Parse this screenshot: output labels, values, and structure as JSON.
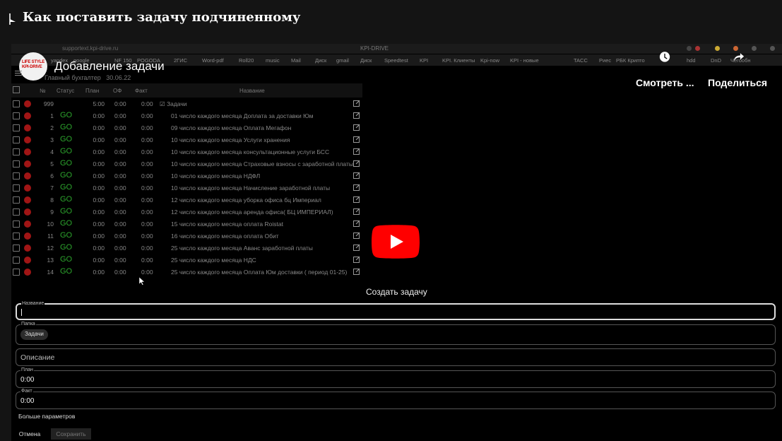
{
  "page": {
    "title": "Как поставить задачу подчиненному"
  },
  "browser": {
    "url": "supportext.kpi-drive.ru",
    "window_title": "KPI-DRIVE",
    "bookmarks": [
      "yandex",
      "google",
      "NF 150",
      "POGODA",
      "2ГИС",
      "Word-pdf",
      "Roll20",
      "music",
      "Mail",
      "Диск",
      "gmail",
      "Диск",
      "Speedtest",
      "KPI",
      "KPI. Клиенты",
      "Kpi-now",
      "KPI - новые",
      "TACC",
      "Риес",
      "РБК Крипто",
      "hdd",
      "DnD",
      "Чегообн"
    ]
  },
  "youtube": {
    "channel_logo_text": "LIFE STYLE KPI-DRIVE",
    "video_title": "Добавление задачи",
    "watch_later_label": "Смотреть ...",
    "share_label": "Поделиться"
  },
  "app": {
    "role": "Главный бухгалтер",
    "date": "30.06.22",
    "table": {
      "headers": {
        "num": "№",
        "status": "Статус",
        "plan": "План",
        "of": "ОФ",
        "fact": "Факт",
        "name": "Название"
      },
      "rows": [
        {
          "num": "999",
          "status": "",
          "plan": "5:00",
          "of": "0:00",
          "fact": "0:00",
          "name": "☑ Задачи"
        },
        {
          "num": "1",
          "status": "GO",
          "plan": "0:00",
          "of": "0:00",
          "fact": "0:00",
          "name": "01 число каждого месяца Доплата за доставки Юм"
        },
        {
          "num": "2",
          "status": "GO",
          "plan": "0:00",
          "of": "0:00",
          "fact": "0:00",
          "name": "09 число каждого месяца Оплата Мегафон"
        },
        {
          "num": "3",
          "status": "GO",
          "plan": "0:00",
          "of": "0:00",
          "fact": "0:00",
          "name": "10 число каждого месяца Услуги хранения"
        },
        {
          "num": "4",
          "status": "GO",
          "plan": "0:00",
          "of": "0:00",
          "fact": "0:00",
          "name": "10 число каждого месяца консультационные услуги БСС"
        },
        {
          "num": "5",
          "status": "GO",
          "plan": "0:00",
          "of": "0:00",
          "fact": "0:00",
          "name": "10 число каждого месяца Страховые взносы с заработной платы"
        },
        {
          "num": "6",
          "status": "GO",
          "plan": "0:00",
          "of": "0:00",
          "fact": "0:00",
          "name": "10 число каждого месяца НДФЛ"
        },
        {
          "num": "7",
          "status": "GO",
          "plan": "0:00",
          "of": "0:00",
          "fact": "0:00",
          "name": "10 число каждого месяца Начисление заработной платы"
        },
        {
          "num": "8",
          "status": "GO",
          "plan": "0:00",
          "of": "0:00",
          "fact": "0:00",
          "name": "12 число каждого месяца уборка офиса бц Империал"
        },
        {
          "num": "9",
          "status": "GO",
          "plan": "0:00",
          "of": "0:00",
          "fact": "0:00",
          "name": "12 число каждого месяца аренда офиса( БЦ ИМПЕРИАЛ)"
        },
        {
          "num": "10",
          "status": "GO",
          "plan": "0:00",
          "of": "0:00",
          "fact": "0:00",
          "name": "15 число каждого месяца оплата  Roistat"
        },
        {
          "num": "11",
          "status": "GO",
          "plan": "0:00",
          "of": "0:00",
          "fact": "0:00",
          "name": "16 число каждого месяца оплата Обит"
        },
        {
          "num": "12",
          "status": "GO",
          "plan": "0:00",
          "of": "0:00",
          "fact": "0:00",
          "name": "25 число каждого месяца Аванс заработной платы"
        },
        {
          "num": "13",
          "status": "GO",
          "plan": "0:00",
          "of": "0:00",
          "fact": "0:00",
          "name": "25 число каждого месяца НДС"
        },
        {
          "num": "14",
          "status": "GO",
          "plan": "0:00",
          "of": "0:00",
          "fact": "0:00",
          "name": "25 число каждого месяца Оплата Юм доставки ( период  01-25)"
        }
      ]
    }
  },
  "form": {
    "title": "Создать задачу",
    "name_label": "Название",
    "name_value": "",
    "folder_label": "Папка",
    "folder_chip": "Задачи",
    "description_placeholder": "Описание",
    "plan_label": "План",
    "plan_value": "0:00",
    "fact_label": "Факт",
    "fact_value": "0:00",
    "more_params": "Больше параметров",
    "cancel_label": "Отмена",
    "save_label": "Сохранить"
  },
  "colors": {
    "status_go": "#2da62d",
    "status_dot": "#a01515",
    "youtube_red": "#ff0000"
  }
}
